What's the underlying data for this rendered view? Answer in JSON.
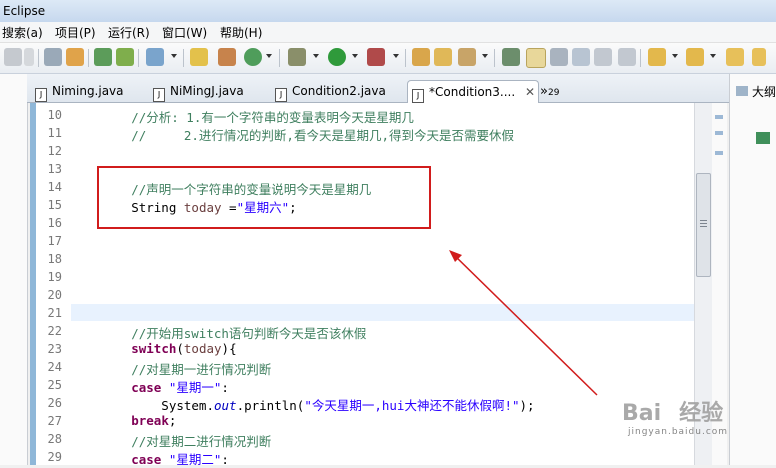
{
  "window": {
    "title": "Eclipse"
  },
  "menu": [
    "搜索(a)",
    "项目(P)",
    "运行(R)",
    "窗口(W)",
    "帮助(H)"
  ],
  "tabs": [
    {
      "label": "Niming.java",
      "active": false
    },
    {
      "label": "NiMingJ.java",
      "active": false
    },
    {
      "label": "Condition2.java",
      "active": false
    },
    {
      "label": "*Condition3....",
      "active": true
    }
  ],
  "overflow_tabs": {
    "glyph": "»",
    "count": "29"
  },
  "outline_panel": {
    "label": "大纲"
  },
  "editor": {
    "lines": [
      {
        "n": "10",
        "segs": [
          {
            "t": "        //分析: 1.有一个字符串的变量表明今天是星期几",
            "c": "cm"
          }
        ]
      },
      {
        "n": "11",
        "segs": [
          {
            "t": "        //     2.进行情况的判断,看今天是星期几,得到今天是否需要休假",
            "c": "cm"
          }
        ]
      },
      {
        "n": "12",
        "segs": []
      },
      {
        "n": "13",
        "segs": []
      },
      {
        "n": "14",
        "segs": [
          {
            "t": "        //声明一个字符串的变量说明今天是星期几",
            "c": "cm"
          }
        ]
      },
      {
        "n": "15",
        "segs": [
          {
            "t": "        String ",
            "c": ""
          },
          {
            "t": "today",
            "c": "var"
          },
          {
            "t": " =",
            "c": ""
          },
          {
            "t": "\"星期六\"",
            "c": "st"
          },
          {
            "t": ";",
            "c": ""
          }
        ]
      },
      {
        "n": "16",
        "segs": []
      },
      {
        "n": "17",
        "segs": []
      },
      {
        "n": "18",
        "segs": []
      },
      {
        "n": "19",
        "segs": []
      },
      {
        "n": "20",
        "segs": []
      },
      {
        "n": "21",
        "segs": []
      },
      {
        "n": "22",
        "segs": [
          {
            "t": "        //开始用switch语句判断今天是否该休假",
            "c": "cm"
          }
        ]
      },
      {
        "n": "23",
        "segs": [
          {
            "t": "        ",
            "c": ""
          },
          {
            "t": "switch",
            "c": "kw"
          },
          {
            "t": "(",
            "c": ""
          },
          {
            "t": "today",
            "c": "var"
          },
          {
            "t": "){",
            "c": ""
          }
        ]
      },
      {
        "n": "24",
        "segs": [
          {
            "t": "        //对星期一进行情况判断",
            "c": "cm"
          }
        ]
      },
      {
        "n": "25",
        "segs": [
          {
            "t": "        ",
            "c": ""
          },
          {
            "t": "case",
            "c": "kw"
          },
          {
            "t": " ",
            "c": ""
          },
          {
            "t": "\"星期一\"",
            "c": "st"
          },
          {
            "t": ":",
            "c": ""
          }
        ]
      },
      {
        "n": "26",
        "segs": [
          {
            "t": "            System.",
            "c": ""
          },
          {
            "t": "out",
            "c": "fld"
          },
          {
            "t": ".println(",
            "c": ""
          },
          {
            "t": "\"今天星期一,hui大神还不能休假啊!\"",
            "c": "st"
          },
          {
            "t": ");",
            "c": ""
          }
        ]
      },
      {
        "n": "27",
        "segs": [
          {
            "t": "        ",
            "c": ""
          },
          {
            "t": "break",
            "c": "kw"
          },
          {
            "t": ";",
            "c": ""
          }
        ]
      },
      {
        "n": "28",
        "segs": [
          {
            "t": "        //对星期二进行情况判断",
            "c": "cm"
          }
        ]
      },
      {
        "n": "29",
        "segs": [
          {
            "t": "        ",
            "c": ""
          },
          {
            "t": "case",
            "c": "kw"
          },
          {
            "t": " ",
            "c": ""
          },
          {
            "t": "\"星期二\"",
            "c": "st"
          },
          {
            "t": ":",
            "c": ""
          }
        ]
      }
    ]
  },
  "watermark": {
    "brand": "Bai",
    "suffix": "经验",
    "url": "jingyan.baidu.com"
  },
  "colors": {
    "annotation": "#d11c1c",
    "comment": "#3f7f5f",
    "keyword": "#7f0055",
    "string": "#2a00ff"
  }
}
